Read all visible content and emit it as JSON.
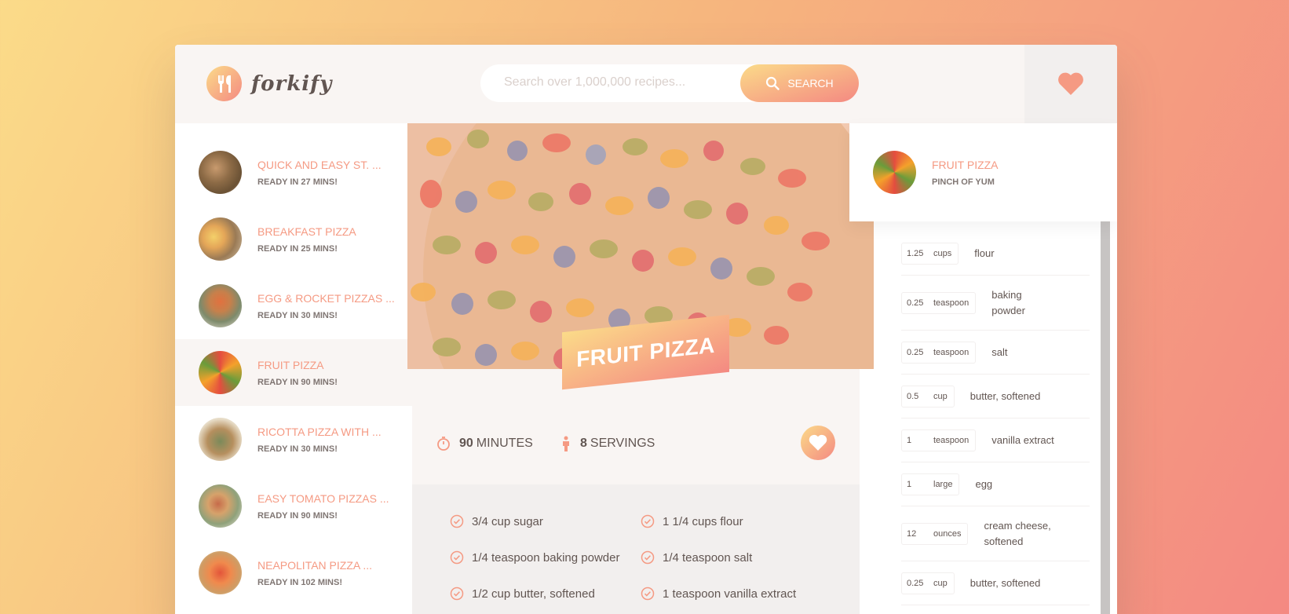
{
  "app": {
    "name": "forkify"
  },
  "search": {
    "placeholder": "Search over 1,000,000 recipes...",
    "button_label": "SEARCH"
  },
  "results": [
    {
      "title": "QUICK AND EASY ST. ...",
      "time": "READY IN 27 MINS!"
    },
    {
      "title": "BREAKFAST PIZZA",
      "time": "READY IN 25 MINS!"
    },
    {
      "title": "EGG & ROCKET PIZZAS ...",
      "time": "READY IN 30 MINS!"
    },
    {
      "title": "FRUIT PIZZA",
      "time": "READY IN 90 MINS!"
    },
    {
      "title": "RICOTTA PIZZA WITH ...",
      "time": "READY IN 30 MINS!"
    },
    {
      "title": "EASY TOMATO PIZZAS ...",
      "time": "READY IN 90 MINS!"
    },
    {
      "title": "NEAPOLITAN PIZZA ...",
      "time": "READY IN 102 MINS!"
    }
  ],
  "recipe": {
    "title": "FRUIT PIZZA",
    "minutes": "90",
    "minutes_label": "MINUTES",
    "servings": "8",
    "servings_label": "SERVINGS",
    "ingredients": [
      "3/4 cup sugar",
      "1 1/4 cups flour",
      "1/4 teaspoon baking powder",
      "1/4 teaspoon salt",
      "1/2 cup butter, softened",
      "1 teaspoon vanilla extract"
    ]
  },
  "likes": [
    {
      "title": "FRUIT PIZZA",
      "author": "PINCH OF YUM"
    }
  ],
  "shopping": [
    {
      "count": "1.25",
      "unit": "cups",
      "desc": "flour"
    },
    {
      "count": "0.25",
      "unit": "teaspoon",
      "desc": "baking powder"
    },
    {
      "count": "0.25",
      "unit": "teaspoon",
      "desc": "salt"
    },
    {
      "count": "0.5",
      "unit": "cup",
      "desc": "butter, softened"
    },
    {
      "count": "1",
      "unit": "teaspoon",
      "desc": "vanilla extract"
    },
    {
      "count": "1",
      "unit": "large",
      "desc": "egg"
    },
    {
      "count": "12",
      "unit": "ounces",
      "desc": "cream cheese, softened"
    },
    {
      "count": "0.25",
      "unit": "cup",
      "desc": "butter, softened"
    }
  ],
  "colors": {
    "accent": "#f59a83",
    "text": "#615551",
    "bg_light": "#f9f5f3"
  },
  "icons": {
    "logo": "fork-knife-icon",
    "search": "magnifier-icon",
    "likes": "heart-icon",
    "time": "stopwatch-icon",
    "servings": "person-icon",
    "bookmark": "heart-icon",
    "ingredient": "check-circle-icon"
  }
}
